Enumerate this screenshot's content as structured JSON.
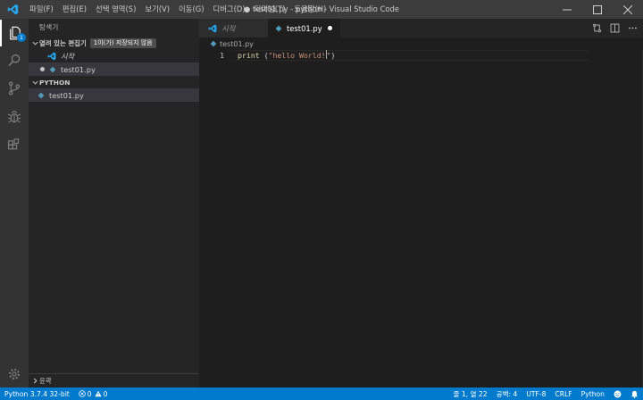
{
  "titlebar": {
    "title": "● test01.py - python - Visual Studio Code",
    "menu": [
      "파일(F)",
      "편집(E)",
      "선택 영역(S)",
      "보기(V)",
      "이동(G)",
      "디버그(D)",
      "터미널(T)",
      "도움말(H)"
    ]
  },
  "activity": {
    "explorer_badge": "1"
  },
  "sidebar": {
    "title": "탐색기",
    "open_editors": {
      "label": "열려 있는 편집기",
      "unsaved_badge": "1이(가) 저장되지 않음",
      "items": [
        "시작",
        "test01.py"
      ]
    },
    "folder": {
      "label": "PYTHON",
      "items": [
        "test01.py"
      ]
    },
    "outline_label": "윤곽"
  },
  "tabs": [
    {
      "label": "시작"
    },
    {
      "label": "test01.py"
    }
  ],
  "breadcrumb": "test01.py",
  "editor": {
    "line_number": "1",
    "code": {
      "fn": "print",
      "space_paren": " (",
      "string": "\"hello World!",
      "string_end": "\"",
      "close": ")"
    }
  },
  "statusbar": {
    "interpreter": "Python 3.7.4 32-bit",
    "errors": "0",
    "warnings": "0",
    "position": "줄 1, 열 22",
    "spaces": "공백: 4",
    "encoding": "UTF-8",
    "eol": "CRLF",
    "language": "Python"
  },
  "colors": {
    "accent": "#007acc",
    "vscode_blue": "#23a9f2",
    "python_icon": "#519aba"
  }
}
